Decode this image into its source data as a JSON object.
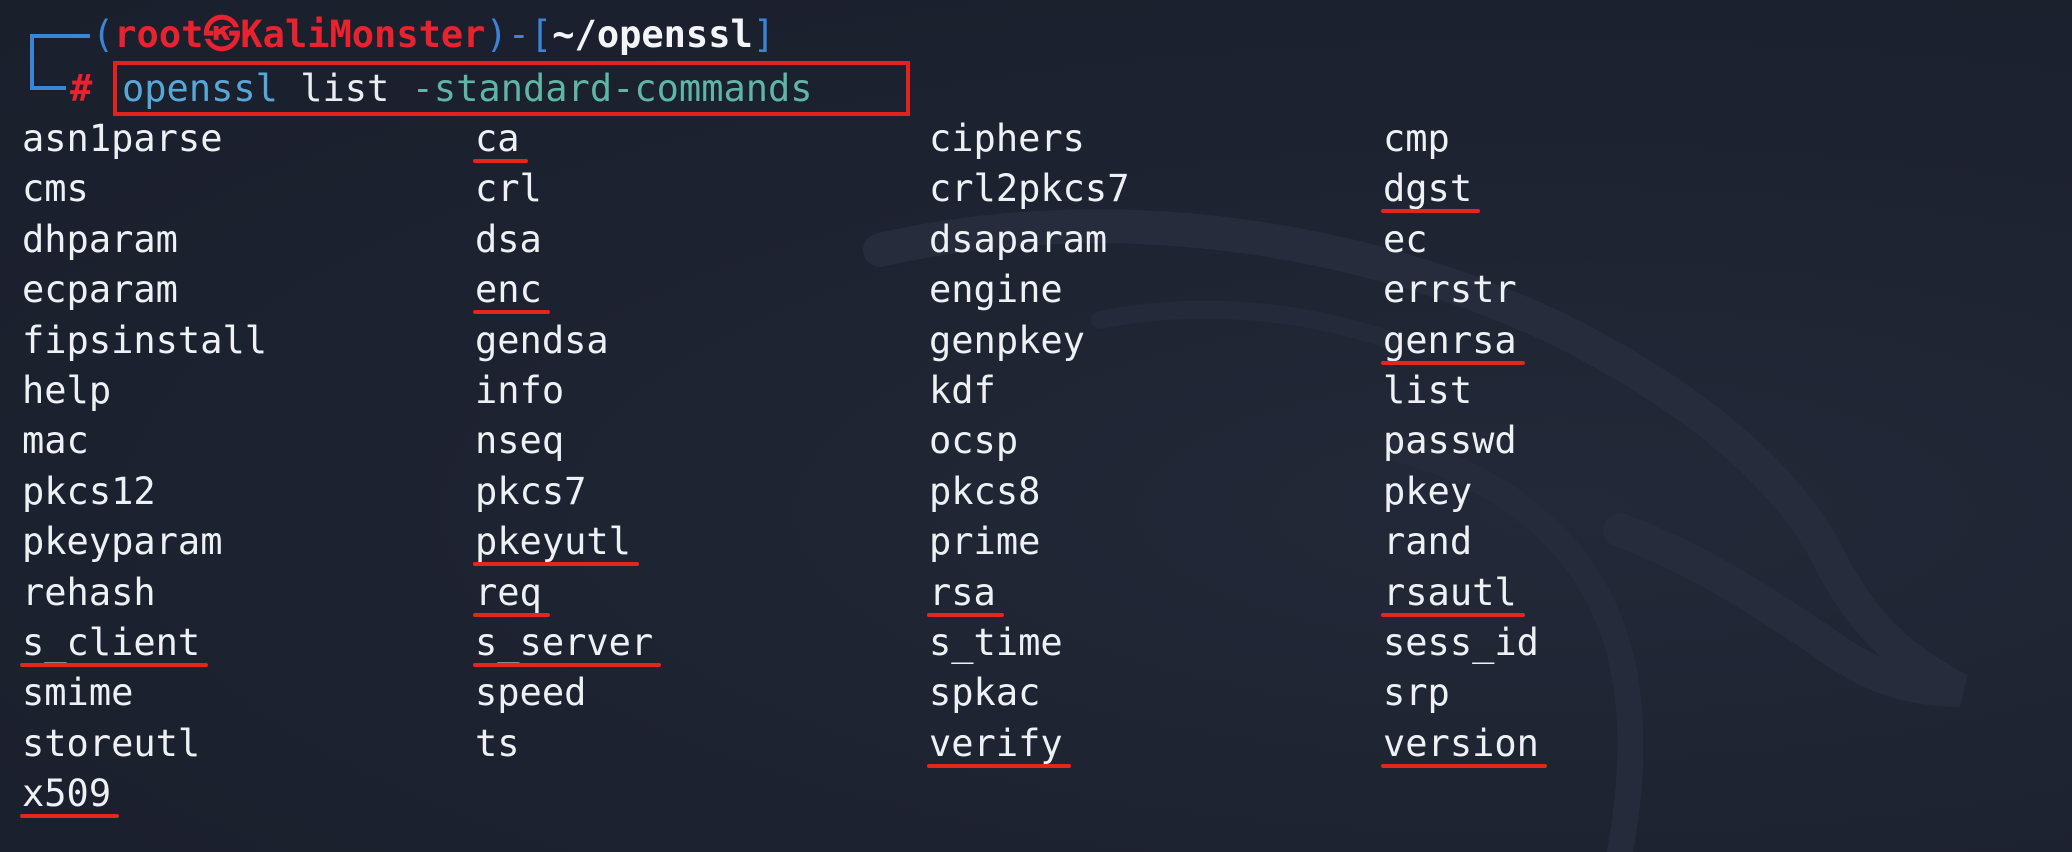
{
  "prompt": {
    "open_paren": "(",
    "user": "root",
    "at_symbol": "㉿",
    "host": "KaliMonster",
    "close_paren_dash": ")-[",
    "path": "~/openssl",
    "close_bracket": "]",
    "hash": "#"
  },
  "command": {
    "name": "openssl",
    "arg": "list",
    "option": "-standard-commands"
  },
  "rows": [
    [
      "asn1parse",
      "ca",
      "ciphers",
      "cmp"
    ],
    [
      "cms",
      "crl",
      "crl2pkcs7",
      "dgst"
    ],
    [
      "dhparam",
      "dsa",
      "dsaparam",
      "ec"
    ],
    [
      "ecparam",
      "enc",
      "engine",
      "errstr"
    ],
    [
      "fipsinstall",
      "gendsa",
      "genpkey",
      "genrsa"
    ],
    [
      "help",
      "info",
      "kdf",
      "list"
    ],
    [
      "mac",
      "nseq",
      "ocsp",
      "passwd"
    ],
    [
      "pkcs12",
      "pkcs7",
      "pkcs8",
      "pkey"
    ],
    [
      "pkeyparam",
      "pkeyutl",
      "prime",
      "rand"
    ],
    [
      "rehash",
      "req",
      "rsa",
      "rsautl"
    ],
    [
      "s_client",
      "s_server",
      "s_time",
      "sess_id"
    ],
    [
      "smime",
      "speed",
      "spkac",
      "srp"
    ],
    [
      "storeutl",
      "ts",
      "verify",
      "version"
    ],
    [
      "x509"
    ]
  ],
  "highlighted_commands": [
    "ca",
    "dgst",
    "enc",
    "genrsa",
    "pkeyutl",
    "req",
    "rsa",
    "rsautl",
    "s_client",
    "s_server",
    "verify",
    "version",
    "x509"
  ],
  "colors": {
    "background": "#1d2230",
    "prompt_blue": "#3b84d6",
    "prompt_red": "#e8232f",
    "command_blue": "#58a7d9",
    "option_teal": "#5fb6a7",
    "annotation_red": "#e0231c"
  }
}
